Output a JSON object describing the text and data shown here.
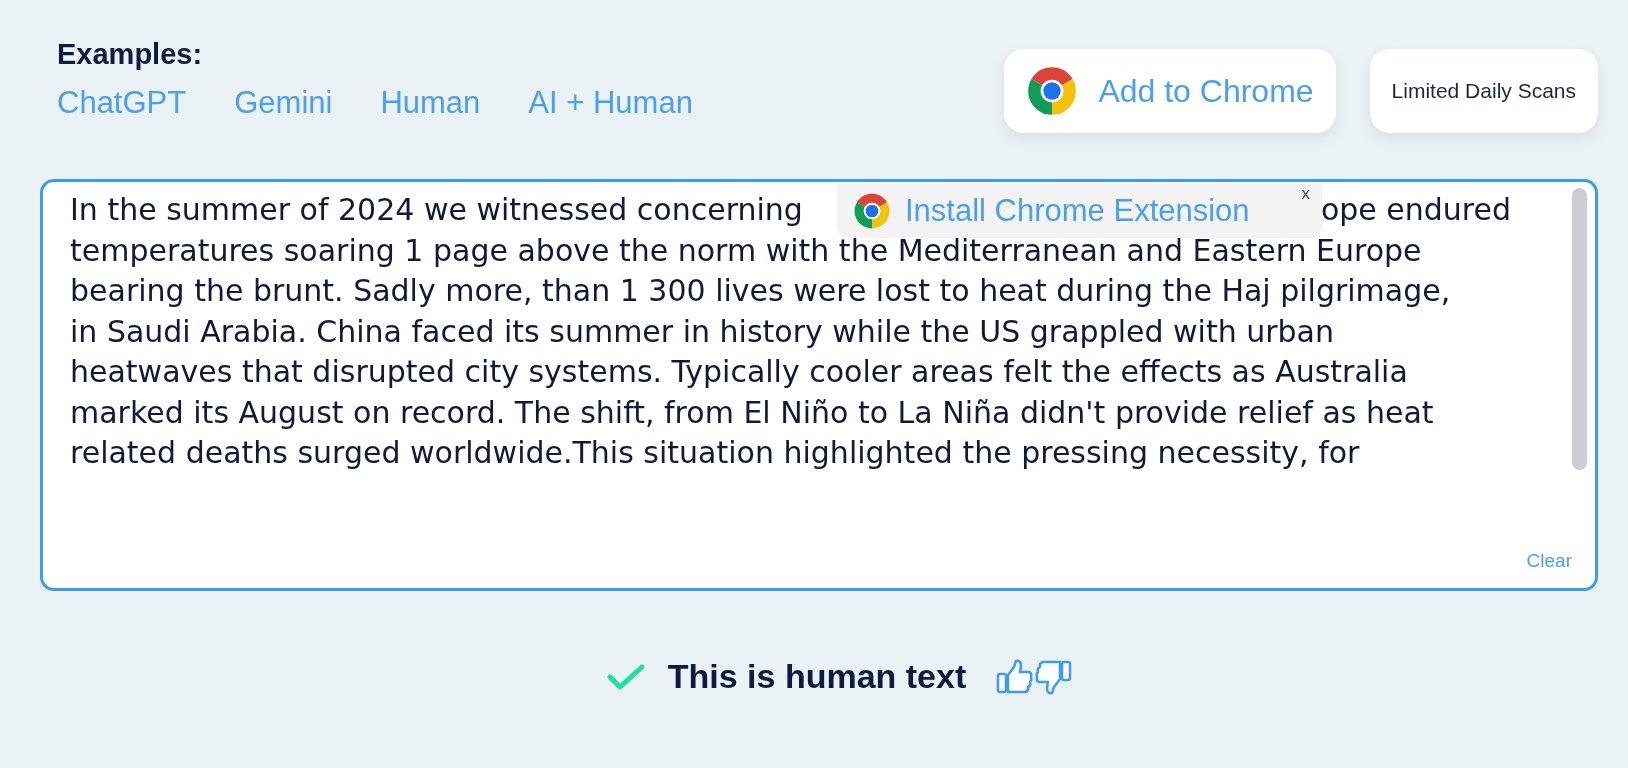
{
  "examples": {
    "title": "Examples:",
    "links": [
      "ChatGPT",
      "Gemini",
      "Human",
      "AI + Human"
    ]
  },
  "header_buttons": [
    {
      "kind": "chrome",
      "label": "Add to Chrome"
    },
    {
      "kind": "plain",
      "label": "Limited Daily Scans"
    }
  ],
  "editor": {
    "lines": [
      [
        "In the summer of 2024 we witnessed concerning",
        "ope endured"
      ],
      [
        "temperatures soaring 1 page above the norm with the Mediterranean and Eastern Europe"
      ],
      [
        "bearing the brunt. Sadly more, than 1 300 lives were lost to heat during the Haj pilgrimage,"
      ],
      [
        "in Saudi Arabia. China faced its summer in history while the US grappled with urban"
      ],
      [
        "heatwaves that disrupted city systems. Typically cooler areas felt the effects as Australia"
      ],
      [
        "marked its August on record. The shift, from El Niño to La Niña didn't provide relief as heat"
      ],
      [
        "related deaths surged worldwide.This situation highlighted the pressing necessity, for"
      ]
    ],
    "clear": "Clear"
  },
  "popup": {
    "label": "Install Chrome Extension",
    "close": "x"
  },
  "result": {
    "label": "This is human text"
  }
}
